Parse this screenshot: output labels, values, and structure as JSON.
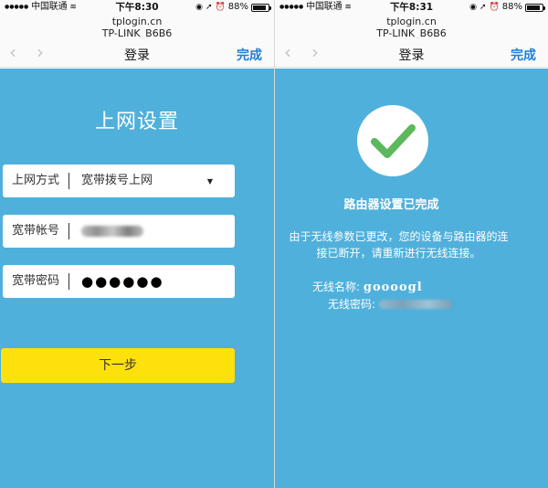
{
  "left": {
    "status": {
      "carrier": "中国联通",
      "time": "下午8:30",
      "battery": "88%"
    },
    "url": {
      "host": "tplogin.cn",
      "ssid": "TP-LINK_B6B6"
    },
    "nav": {
      "title": "登录",
      "done": "完成"
    },
    "heading": "上网设置",
    "fields": [
      {
        "label": "上网方式",
        "value": "宽带拨号上网"
      },
      {
        "label": "宽带帐号",
        "value": ""
      },
      {
        "label": "宽带密码",
        "value": "●●●●●●"
      }
    ],
    "next_button": "下一步"
  },
  "right": {
    "status": {
      "carrier": "中国联通",
      "time": "下午8:31",
      "battery": "88%"
    },
    "url": {
      "host": "tplogin.cn",
      "ssid": "TP-LINK_B6B6"
    },
    "nav": {
      "title": "登录",
      "done": "完成"
    },
    "success_title": "路由器设置已完成",
    "desc_line1": "由于无线参数已更改，您的设备与路由器的连",
    "desc_line2": "接已断开，请重新进行无线连接。",
    "wifi_name_label": "无线名称:",
    "wifi_name_value": "goooogl",
    "wifi_pwd_label": "无线密码:"
  },
  "colors": {
    "page_blue": "#4fb0dc",
    "accent_link": "#1e7fd6",
    "button_yellow": "#fce10c",
    "check_green": "#5cb85c"
  },
  "icons": {
    "back": "chevron-left-icon",
    "forward": "chevron-right-icon",
    "wifi": "wifi-icon",
    "check": "check-icon"
  }
}
